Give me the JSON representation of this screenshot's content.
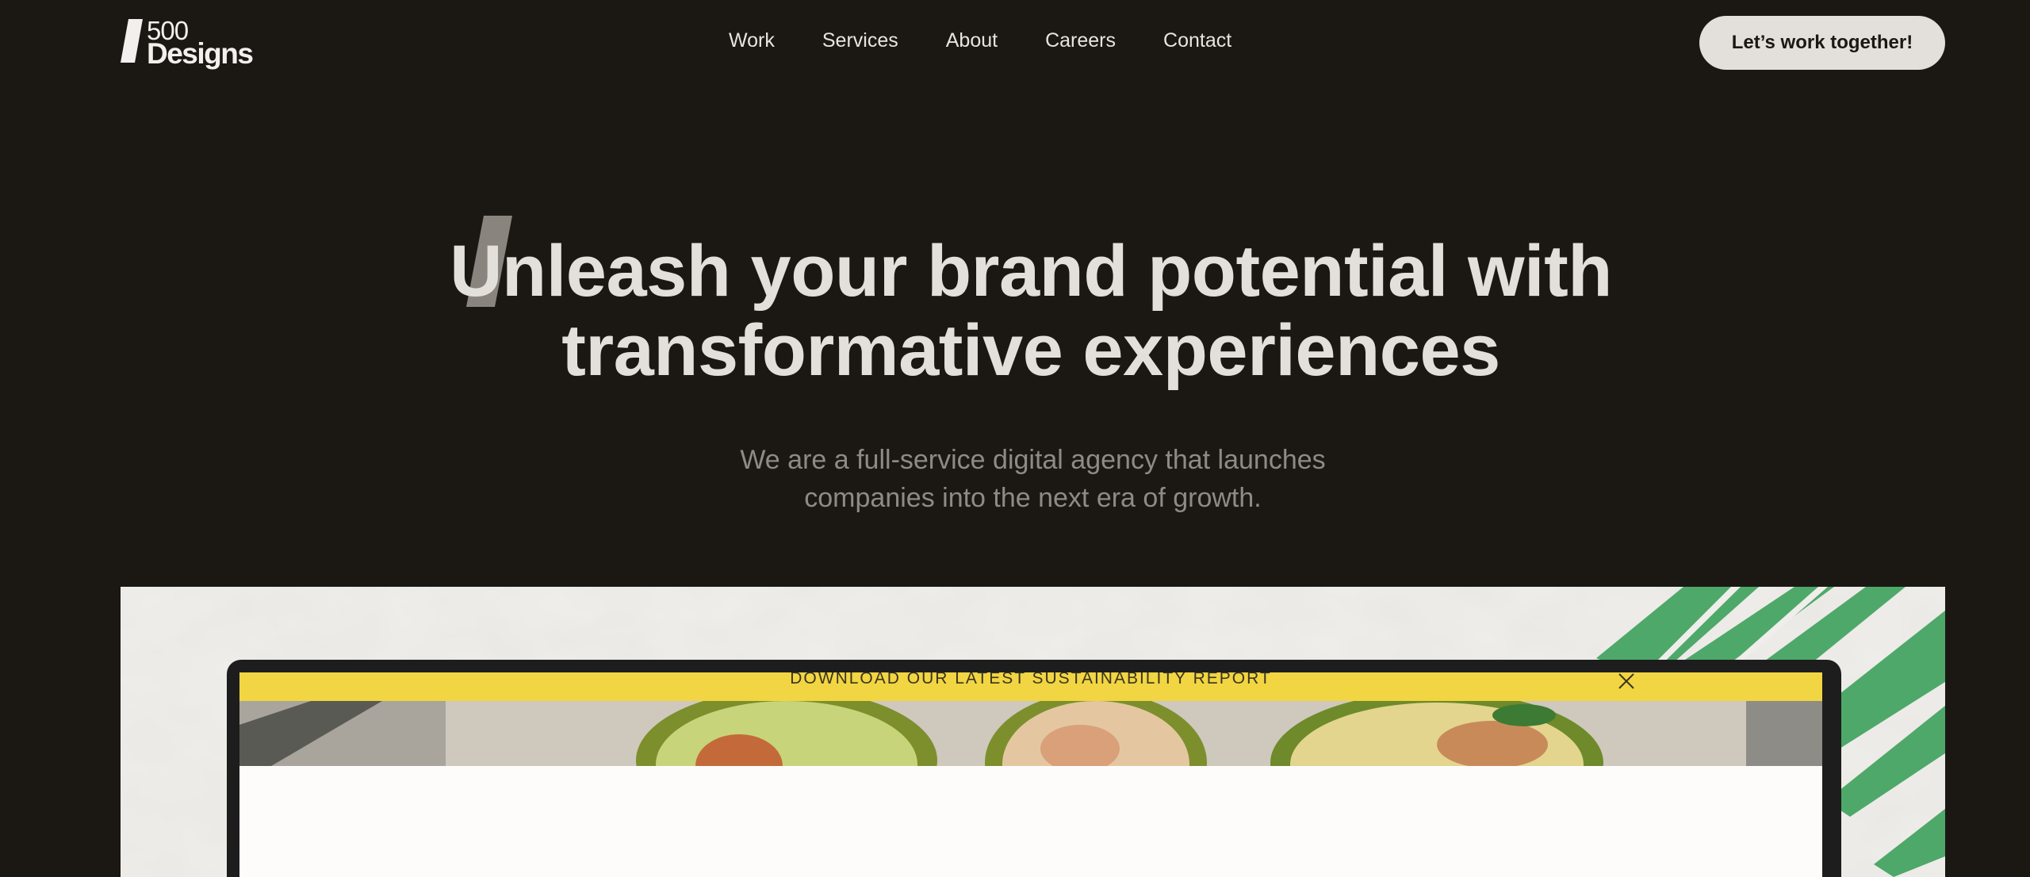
{
  "header": {
    "logo_number": "500",
    "logo_word": "Designs",
    "nav": [
      "Work",
      "Services",
      "About",
      "Careers",
      "Contact"
    ],
    "cta_label": "Let’s work together!"
  },
  "hero": {
    "title": "Unleash your brand potential with transformative experiences",
    "subtitle": "We are a full-service digital agency that launches companies into the next era of growth."
  },
  "showcase": {
    "banner_text": "DOWNLOAD OUR LATEST SUSTAINABILITY REPORT"
  },
  "colors": {
    "background": "#1b1814",
    "text_light": "#e3dfdb",
    "text_muted": "#8f8a86",
    "slash_accent": "#8a847f",
    "banner_yellow": "#f2d542",
    "leaf_green": "#4ea86a"
  },
  "icons": [
    "logo-slash-icon",
    "hero-slash-icon",
    "close-icon"
  ]
}
